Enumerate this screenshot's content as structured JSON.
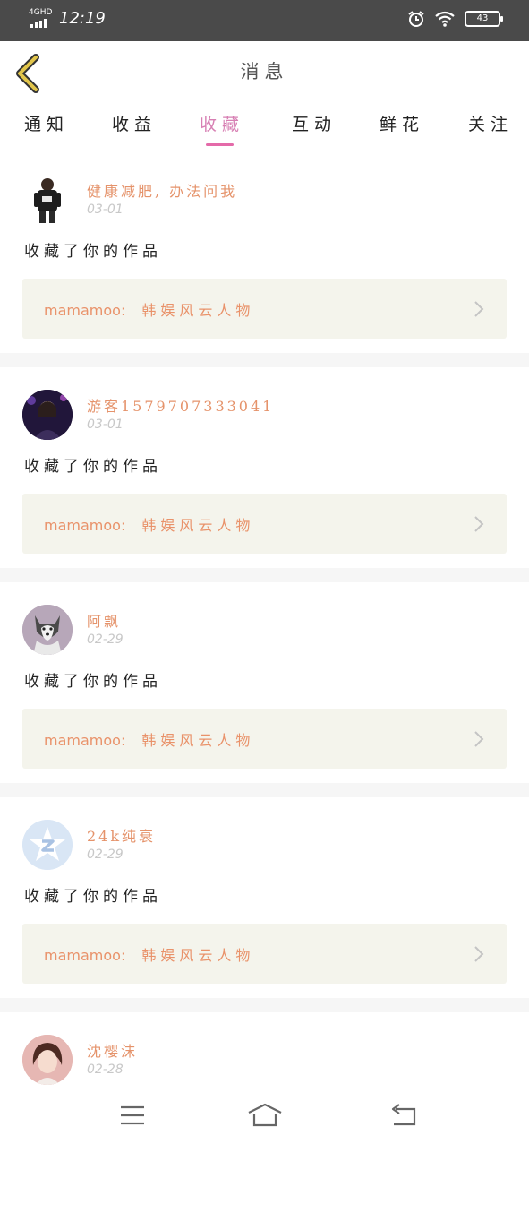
{
  "status_bar": {
    "network": "4GHD",
    "time": "12:19",
    "battery": "43",
    "icons": [
      "alarm-icon",
      "wifi-icon",
      "battery-icon"
    ]
  },
  "header": {
    "title": "消息",
    "back_icon": "chevron-left-icon",
    "accent": "#d8b53a"
  },
  "tabs": {
    "items": [
      "通知",
      "收益",
      "收藏",
      "互动",
      "鲜花",
      "关注"
    ],
    "active_index": 2,
    "active_color": "#d77fb3"
  },
  "messages": [
    {
      "name": "健康减肥, 办法问我",
      "date": "03-01",
      "action": "收藏了你的作品",
      "work_author": "mamamoo:",
      "work_title": "韩娱风云人物"
    },
    {
      "name": "游客1579707333041",
      "date": "03-01",
      "action": "收藏了你的作品",
      "work_author": "mamamoo:",
      "work_title": "韩娱风云人物"
    },
    {
      "name": "阿飘",
      "date": "02-29",
      "action": "收藏了你的作品",
      "work_author": "mamamoo:",
      "work_title": "韩娱风云人物"
    },
    {
      "name": "24k纯衰",
      "date": "02-29",
      "action": "收藏了你的作品",
      "work_author": "mamamoo:",
      "work_title": "韩娱风云人物"
    },
    {
      "name": "沈樱沫",
      "date": "02-28"
    }
  ],
  "nav_keys": [
    "menu-icon",
    "home-icon",
    "back-icon"
  ]
}
